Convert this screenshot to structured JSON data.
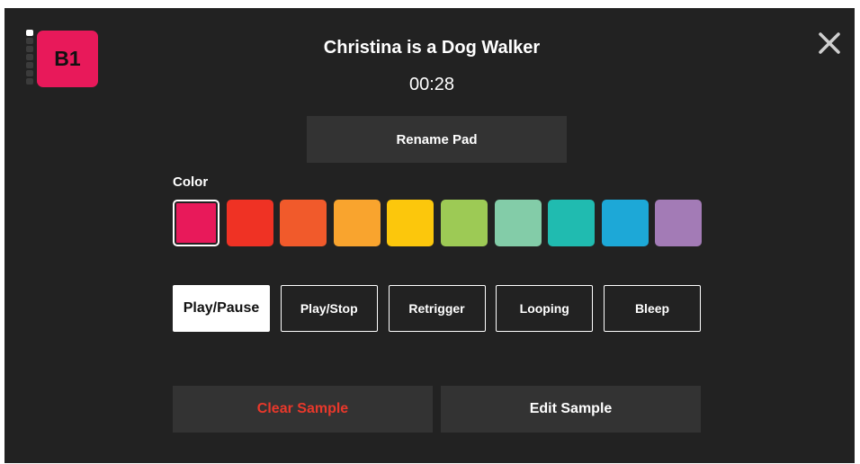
{
  "pad": {
    "label": "B1",
    "color": "#e8195a"
  },
  "level_meter": {
    "active_segments": 1,
    "total_segments": 7
  },
  "header": {
    "title": "Christina is a Dog Walker",
    "duration": "00:28",
    "close_icon": "close-icon"
  },
  "rename_button": "Rename Pad",
  "color_section": {
    "label": "Color",
    "selected_index": 0,
    "swatches": [
      "#e8195a",
      "#ef3224",
      "#f15a2b",
      "#f9a42e",
      "#fcc70c",
      "#9dca55",
      "#83cca8",
      "#20bbb0",
      "#1da8d7",
      "#a37bb6"
    ]
  },
  "modes": {
    "active_index": 0,
    "items": [
      "Play/Pause",
      "Play/Stop",
      "Retrigger",
      "Looping",
      "Bleep"
    ]
  },
  "actions": {
    "clear_label": "Clear Sample",
    "clear_color": "#e9382b",
    "edit_label": "Edit Sample"
  }
}
